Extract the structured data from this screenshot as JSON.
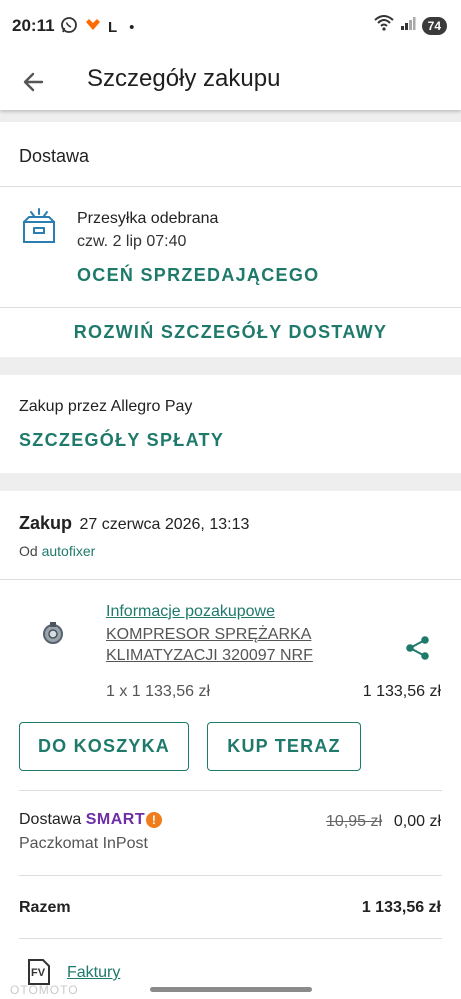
{
  "status_bar": {
    "time": "20:11",
    "carrier_letter": "L",
    "dot": "•",
    "battery": "74"
  },
  "app_bar": {
    "title": "Szczegóły zakupu"
  },
  "delivery": {
    "heading": "Dostawa",
    "status": "Przesyłka odebrana",
    "date": "czw. 2 lip 07:40",
    "rate_seller": "OCEŃ SPRZEDAJĄCEGO",
    "expand_details": "ROZWIŃ SZCZEGÓŁY DOSTAWY"
  },
  "payment": {
    "label": "Zakup przez Allegro Pay",
    "details_link": "SZCZEGÓŁY SPŁATY"
  },
  "purchase": {
    "label": "Zakup",
    "date": "27 czerwca 2026, 13:13",
    "from_label": "Od",
    "seller": "autofixer",
    "info_link": "Informacje pozakupowe",
    "product_line1": "KOMPRESOR SPRĘŻARKA",
    "product_line2": "KLIMATYZACJI 320097 NRF",
    "quantity_price": "1 x 1 133,56 zł",
    "total_price": "1 133,56 zł",
    "add_to_cart": "DO KOSZYKA",
    "buy_now": "KUP TERAZ"
  },
  "shipping": {
    "label": "Dostawa",
    "smart_logo": "SMART",
    "smart_mark": "!",
    "method": "Paczkomat InPost",
    "old_price": "10,95 zł",
    "new_price": "0,00 zł"
  },
  "summary": {
    "label": "Razem",
    "total": "1 133,56 zł"
  },
  "invoices": {
    "icon_text": "FV",
    "link": "Faktury"
  },
  "watermark": "OTOMOTO",
  "colors": {
    "accent": "#1f7a6b",
    "smart": "#6d2ea8",
    "smart_bang": "#f07c1a",
    "band": "#eeeeee"
  },
  "icons": [
    "whatsapp-icon",
    "allegro-icon",
    "back-arrow-icon",
    "parcel-box-icon",
    "share-icon",
    "wifi-icon",
    "signal-icon",
    "invoice-icon"
  ]
}
